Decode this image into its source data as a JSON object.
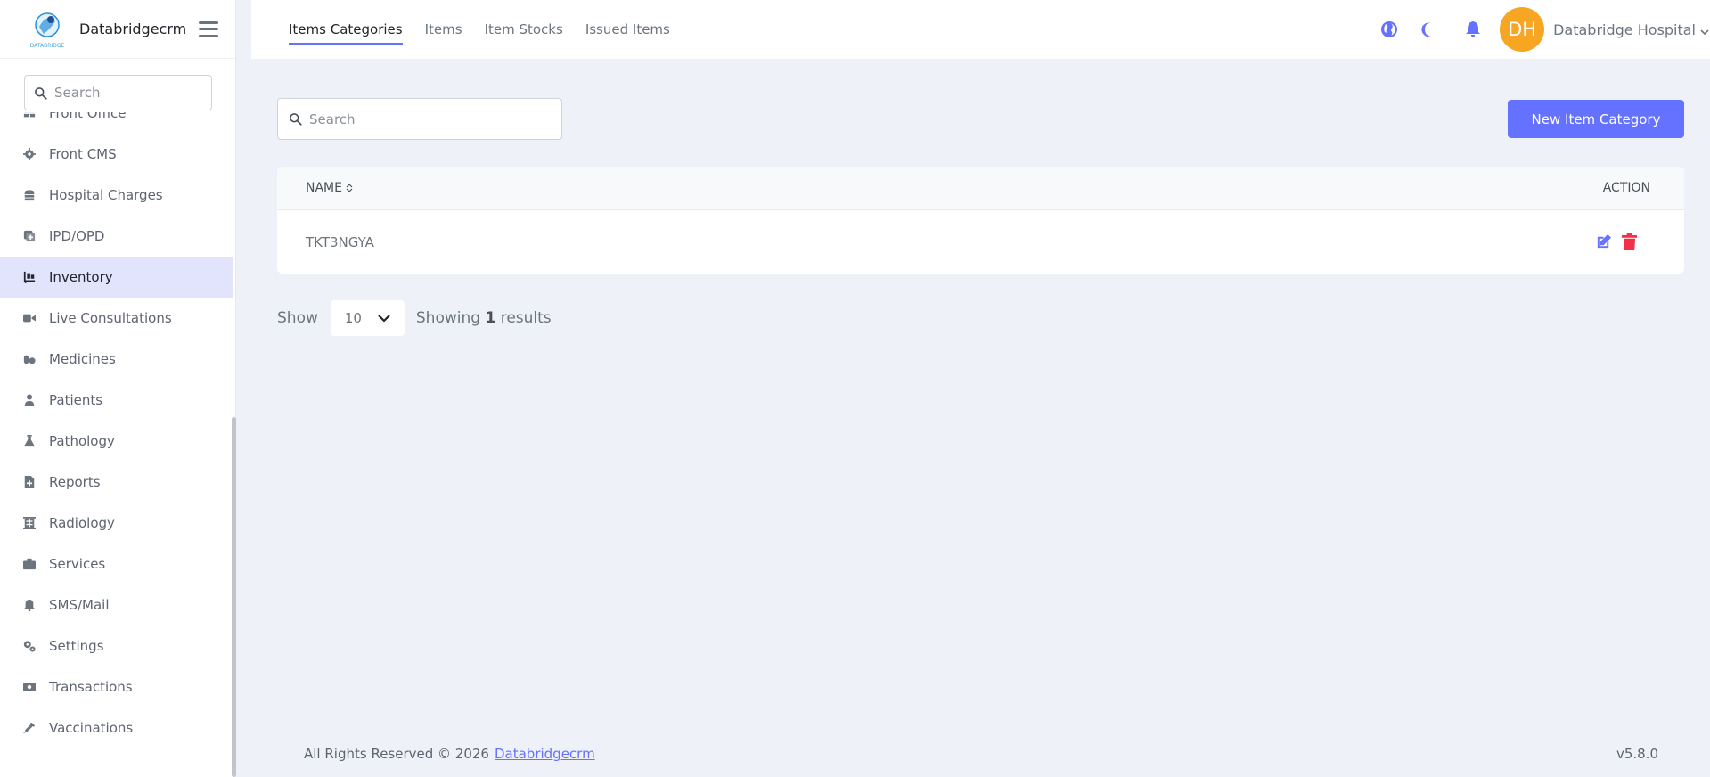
{
  "brand": {
    "name": "Databridgecrm"
  },
  "sidebar": {
    "search_placeholder": "Search",
    "items": [
      {
        "label": "Front Office",
        "icon": "front-office-icon"
      },
      {
        "label": "Front CMS",
        "icon": "gear-icon"
      },
      {
        "label": "Hospital Charges",
        "icon": "coins-icon"
      },
      {
        "label": "IPD/OPD",
        "icon": "ipd-opd-icon"
      },
      {
        "label": "Inventory",
        "icon": "dolly-icon",
        "active": true
      },
      {
        "label": "Live Consultations",
        "icon": "video-icon"
      },
      {
        "label": "Medicines",
        "icon": "capsules-icon"
      },
      {
        "label": "Patients",
        "icon": "user-injured-icon"
      },
      {
        "label": "Pathology",
        "icon": "flask-icon"
      },
      {
        "label": "Reports",
        "icon": "file-medical-icon"
      },
      {
        "label": "Radiology",
        "icon": "x-ray-icon"
      },
      {
        "label": "Services",
        "icon": "briefcase-icon"
      },
      {
        "label": "SMS/Mail",
        "icon": "bell-icon"
      },
      {
        "label": "Settings",
        "icon": "gears-icon"
      },
      {
        "label": "Transactions",
        "icon": "money-bill-icon"
      },
      {
        "label": "Vaccinations",
        "icon": "syringe-icon"
      }
    ]
  },
  "header": {
    "tabs": [
      {
        "label": "Items Categories",
        "active": true
      },
      {
        "label": "Items"
      },
      {
        "label": "Item Stocks"
      },
      {
        "label": "Issued Items"
      }
    ],
    "avatar_initials": "DH",
    "user_name": "Databridge Hospital"
  },
  "main": {
    "search_placeholder": "Search",
    "new_button_label": "New Item Category",
    "table": {
      "columns": [
        "NAME",
        "ACTION"
      ],
      "rows": [
        {
          "name": "TKT3NGYA"
        }
      ]
    },
    "pager": {
      "show_label": "Show",
      "page_size": "10",
      "showing_prefix": "Showing",
      "count": "1",
      "showing_suffix": "results"
    }
  },
  "footer": {
    "text": "All Rights Reserved © 2026",
    "link": "Databridgecrm",
    "version": "v5.8.0"
  },
  "colors": {
    "accent": "#6571ff",
    "avatar": "#f6a623",
    "delete": "#f1304a",
    "active_bg": "#e2e4fd"
  }
}
